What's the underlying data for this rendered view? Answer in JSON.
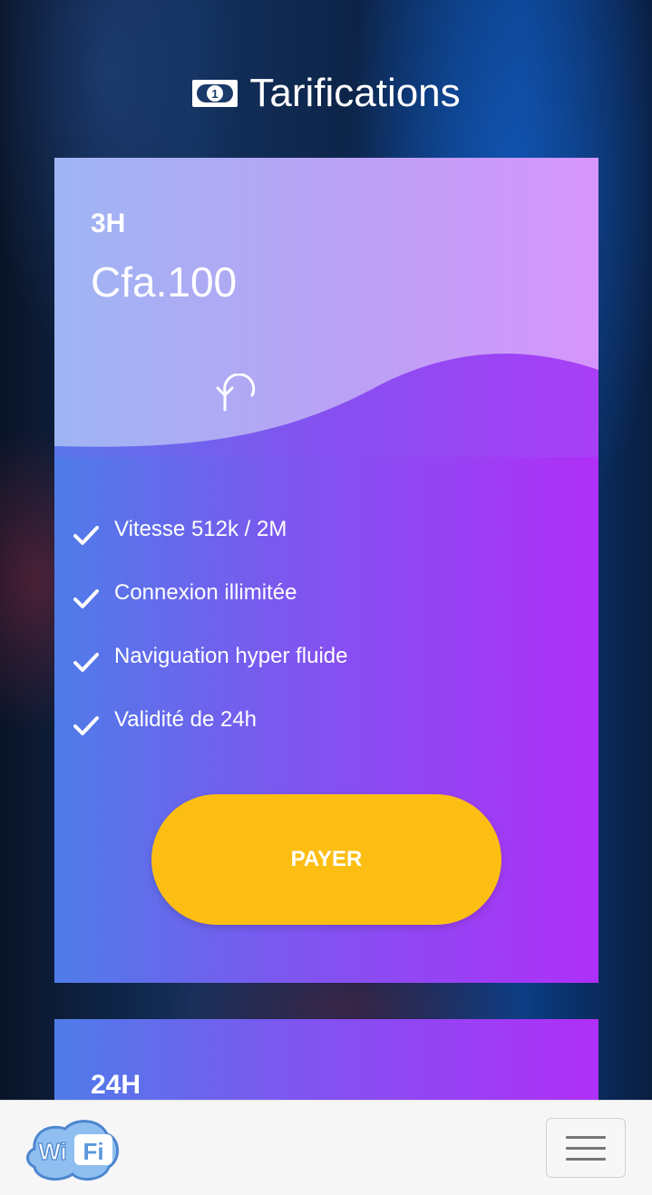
{
  "header": {
    "title": "Tarifications",
    "icon": "money-bill-icon"
  },
  "plans": [
    {
      "name": "3H",
      "price": "Cfa.100",
      "icon": "undo-arrow-icon",
      "features": [
        "Vitesse 512k / 2M",
        "Connexion illimitée",
        "Naviguation hyper fluide",
        "Validité de 24h"
      ],
      "button_label": "PAYER"
    },
    {
      "name": "24H"
    }
  ],
  "navbar": {
    "logo_text_left": "Wi",
    "logo_text_right": "Fi",
    "menu_icon": "hamburger-icon"
  },
  "colors": {
    "button": "#fdbe14",
    "card_gradient_start": "#4f7ce8",
    "card_gradient_end": "#b02ff7",
    "logo_blue": "#6fa8e8"
  }
}
